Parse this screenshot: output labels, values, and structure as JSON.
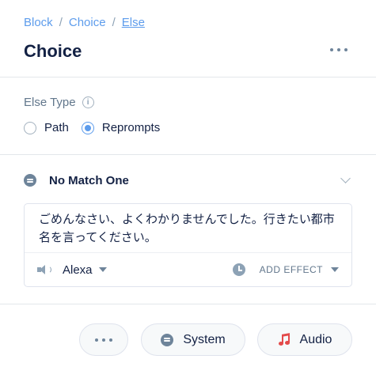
{
  "breadcrumb": {
    "items": [
      "Block",
      "Choice",
      "Else"
    ],
    "separator": "/"
  },
  "header": {
    "title": "Choice",
    "more_icon": "more-horizontal-icon"
  },
  "else_type": {
    "label": "Else Type",
    "info_icon": "info-icon",
    "options": [
      {
        "label": "Path",
        "selected": false
      },
      {
        "label": "Reprompts",
        "selected": true
      }
    ]
  },
  "section": {
    "title": "No Match One",
    "icon": "chat-bubble-icon",
    "chevron": "chevron-down-icon"
  },
  "prompt": {
    "text": "ごめんなさい、よくわかりませんでした。行きたい都市名を言ってください。",
    "voice": "Alexa",
    "effect_label": "ADD EFFECT"
  },
  "buttons": {
    "more_icon": "more-horizontal-icon",
    "system_label": "System",
    "audio_label": "Audio"
  },
  "colors": {
    "accent": "#5d9cec",
    "text": "#132144",
    "muted": "#62778c",
    "audio_icon": "#e34a4a"
  }
}
